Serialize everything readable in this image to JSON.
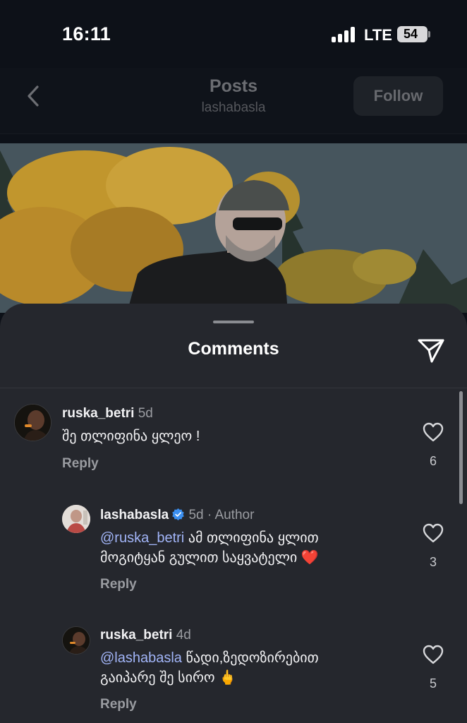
{
  "status_bar": {
    "time": "16:11",
    "network": "LTE",
    "battery": "54"
  },
  "header": {
    "title": "Posts",
    "subtitle": "lashabasla",
    "follow_label": "Follow"
  },
  "sheet": {
    "title": "Comments"
  },
  "comments": [
    {
      "user": "ruska_betri",
      "time": "5d",
      "text": "შე თლიფინა ყლეო !",
      "reply_label": "Reply",
      "likes": "6"
    },
    {
      "user": "lashabasla",
      "time": "5d",
      "author_label": "Author",
      "mention": "@ruska_betri",
      "text_line1": "ამ თლიფინა ყლით",
      "text_line2": "მოგიტყან გულით საყვატელი",
      "emoji": "❤️",
      "reply_label": "Reply",
      "likes": "3"
    },
    {
      "user": "ruska_betri",
      "time": "4d",
      "mention": "@lashabasla",
      "text_line1": "წადი,ზედოზირებით",
      "text_line2": "გაიპარე შე სირო",
      "emoji": "🖕",
      "reply_label": "Reply",
      "likes": "5"
    }
  ]
}
